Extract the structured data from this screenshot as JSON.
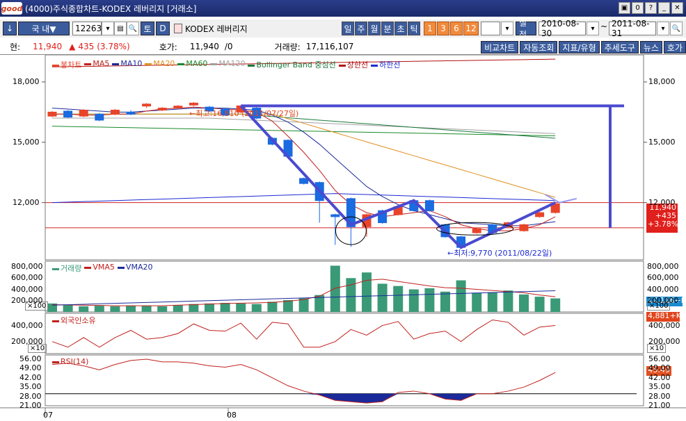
{
  "window": {
    "logo": "good",
    "title": "(4000)주식종합차트-KODEX 레버리지 [거래소]",
    "buttons": [
      "▣",
      "0",
      "?",
      "_",
      "✕"
    ]
  },
  "toolbar": {
    "arrow": "↓",
    "market": "국  내▼",
    "code": "122630",
    "code_dropdown": "▾",
    "icon_list": "▤",
    "icon_search": "🔍",
    "btn_to": "토",
    "btn_d": "D",
    "stock_name": "KODEX 레버리지",
    "periods": [
      "일",
      "주",
      "월",
      "분",
      "초",
      "틱"
    ],
    "counts": [
      "1",
      "3",
      "6",
      "12"
    ],
    "count_input": "",
    "settings": "설정",
    "date_from": "2010-08-30",
    "date_sep": "~",
    "date_to": "2011-08-31",
    "search_btn": "🔍"
  },
  "info": {
    "current_label": "현:",
    "current_price": "11,940",
    "change_arrow": "▲",
    "change_value": "435",
    "change_pct": "(3.78%)",
    "quote_label": "호가:",
    "quote_value": "11,940",
    "quote_extra": "/0",
    "volume_label": "거래량:",
    "volume_value": "17,116,107",
    "tabs": [
      "비교차트",
      "자동조회",
      "지표/유형",
      "추세도구",
      "뉴스",
      "호가"
    ]
  },
  "price_panel": {
    "legend": [
      {
        "label": "봉차트",
        "color": "#e8442a"
      },
      {
        "label": "MA5",
        "color": "#c0201c"
      },
      {
        "label": "MA10",
        "color": "#1a2a9a"
      },
      {
        "label": "MA20",
        "color": "#e09020"
      },
      {
        "label": "MA60",
        "color": "#1a8a2a"
      },
      {
        "label": "MA120",
        "color": "#a0a0a0"
      },
      {
        "label": "Bollinger Band 중심선",
        "color": "#1a7a3a"
      },
      {
        "label": "상한선",
        "color": "#b01010"
      },
      {
        "label": "하한선",
        "color": "#1a2ad0"
      }
    ],
    "y_ticks": [
      "18,000",
      "15,000",
      "12,000"
    ],
    "high_annotation": "←최고:16,810 (2011/07/27일)",
    "low_annotation": "←최저:9,770 (2011/08/22일)",
    "last_tag": [
      "11,940",
      "+435",
      "+3.78%"
    ]
  },
  "volume_panel": {
    "legend": [
      {
        "label": "거래량",
        "color": "#3a9a78"
      },
      {
        "label": "VMA5",
        "color": "#c0201c"
      },
      {
        "label": "VMA20",
        "color": "#1a2a9a"
      }
    ],
    "y_ticks": [
      "800,000",
      "600,000",
      "400,000",
      "200,000"
    ],
    "multiplier": "×100",
    "last_tag": "17,116+K"
  },
  "foreign_panel": {
    "legend": [
      {
        "label": "외국인소유",
        "color": "#c0201c"
      }
    ],
    "y_ticks": [
      "400,000",
      "200,000"
    ],
    "multiplier": "×10",
    "last_tag": "4,881+K"
  },
  "rsi_panel": {
    "legend": [
      {
        "label": "RSI(14)",
        "color": "#c0201c"
      }
    ],
    "y_ticks": [
      "56.00",
      "49.00",
      "42.00",
      "35.00",
      "28.00",
      "21.00"
    ],
    "last_tag": "45.49"
  },
  "x_axis": {
    "labels": [
      "07",
      "08"
    ]
  },
  "chart_data": {
    "type": "candlestick",
    "title": "",
    "period_labels": [
      "07",
      "08"
    ],
    "candles": [
      {
        "open": 16300,
        "close": 16500,
        "high": 16550,
        "low": 16250
      },
      {
        "open": 16550,
        "close": 16250,
        "high": 16600,
        "low": 16200
      },
      {
        "open": 16300,
        "close": 16600,
        "high": 16650,
        "low": 16250
      },
      {
        "open": 16400,
        "close": 16100,
        "high": 16450,
        "low": 16050
      },
      {
        "open": 16400,
        "close": 16600,
        "high": 16650,
        "low": 16350
      },
      {
        "open": 16500,
        "close": 16400,
        "high": 16600,
        "low": 16350
      },
      {
        "open": 16800,
        "close": 16900,
        "high": 16950,
        "low": 16700
      },
      {
        "open": 16600,
        "close": 16700,
        "high": 16750,
        "low": 16550
      },
      {
        "open": 16700,
        "close": 16800,
        "high": 16850,
        "low": 16650
      },
      {
        "open": 16850,
        "close": 16950,
        "high": 17000,
        "low": 16800
      },
      {
        "open": 16750,
        "close": 16550,
        "high": 16800,
        "low": 16500
      },
      {
        "open": 16650,
        "close": 16350,
        "high": 16700,
        "low": 16300
      },
      {
        "open": 16500,
        "close": 16810,
        "high": 16810,
        "low": 16450
      },
      {
        "open": 16700,
        "close": 16200,
        "high": 16750,
        "low": 16150
      },
      {
        "open": 15200,
        "close": 14900,
        "high": 15250,
        "low": 14850
      },
      {
        "open": 15100,
        "close": 14300,
        "high": 15150,
        "low": 14250
      },
      {
        "open": 13200,
        "close": 12950,
        "high": 13250,
        "low": 12900
      },
      {
        "open": 13000,
        "close": 12100,
        "high": 13050,
        "low": 11000
      },
      {
        "open": 11400,
        "close": 11300,
        "high": 11450,
        "low": 9900
      },
      {
        "open": 12200,
        "close": 10800,
        "high": 12250,
        "low": 9800
      },
      {
        "open": 10800,
        "close": 11400,
        "high": 11450,
        "low": 10300
      },
      {
        "open": 11600,
        "close": 11000,
        "high": 11650,
        "low": 10950
      },
      {
        "open": 11400,
        "close": 11800,
        "high": 11850,
        "low": 11350
      },
      {
        "open": 12100,
        "close": 11600,
        "high": 12150,
        "low": 11550
      },
      {
        "open": 12100,
        "close": 11600,
        "high": 12150,
        "low": 11550
      },
      {
        "open": 10900,
        "close": 10300,
        "high": 10950,
        "low": 10250
      },
      {
        "open": 10300,
        "close": 9770,
        "high": 10350,
        "low": 9770
      },
      {
        "open": 10500,
        "close": 10700,
        "high": 10750,
        "low": 10450
      },
      {
        "open": 10900,
        "close": 10500,
        "high": 10950,
        "low": 10450
      },
      {
        "open": 10800,
        "close": 11000,
        "high": 11050,
        "low": 10750
      },
      {
        "open": 10600,
        "close": 10900,
        "high": 10950,
        "low": 10550
      },
      {
        "open": 11300,
        "close": 11500,
        "high": 11550,
        "low": 11250
      },
      {
        "open": 11505,
        "close": 11940,
        "high": 11990,
        "low": 11450
      }
    ],
    "volume": [
      150,
      120,
      100,
      110,
      100,
      110,
      105,
      100,
      120,
      140,
      150,
      160,
      150,
      140,
      180,
      210,
      240,
      300,
      820,
      600,
      700,
      500,
      460,
      400,
      420,
      360,
      560,
      340,
      350,
      380,
      310,
      270,
      240
    ],
    "ylim_price": [
      9500,
      19000
    ],
    "ylim_volume": [
      0,
      850000
    ],
    "ylim_rsi": [
      21,
      56
    ]
  }
}
